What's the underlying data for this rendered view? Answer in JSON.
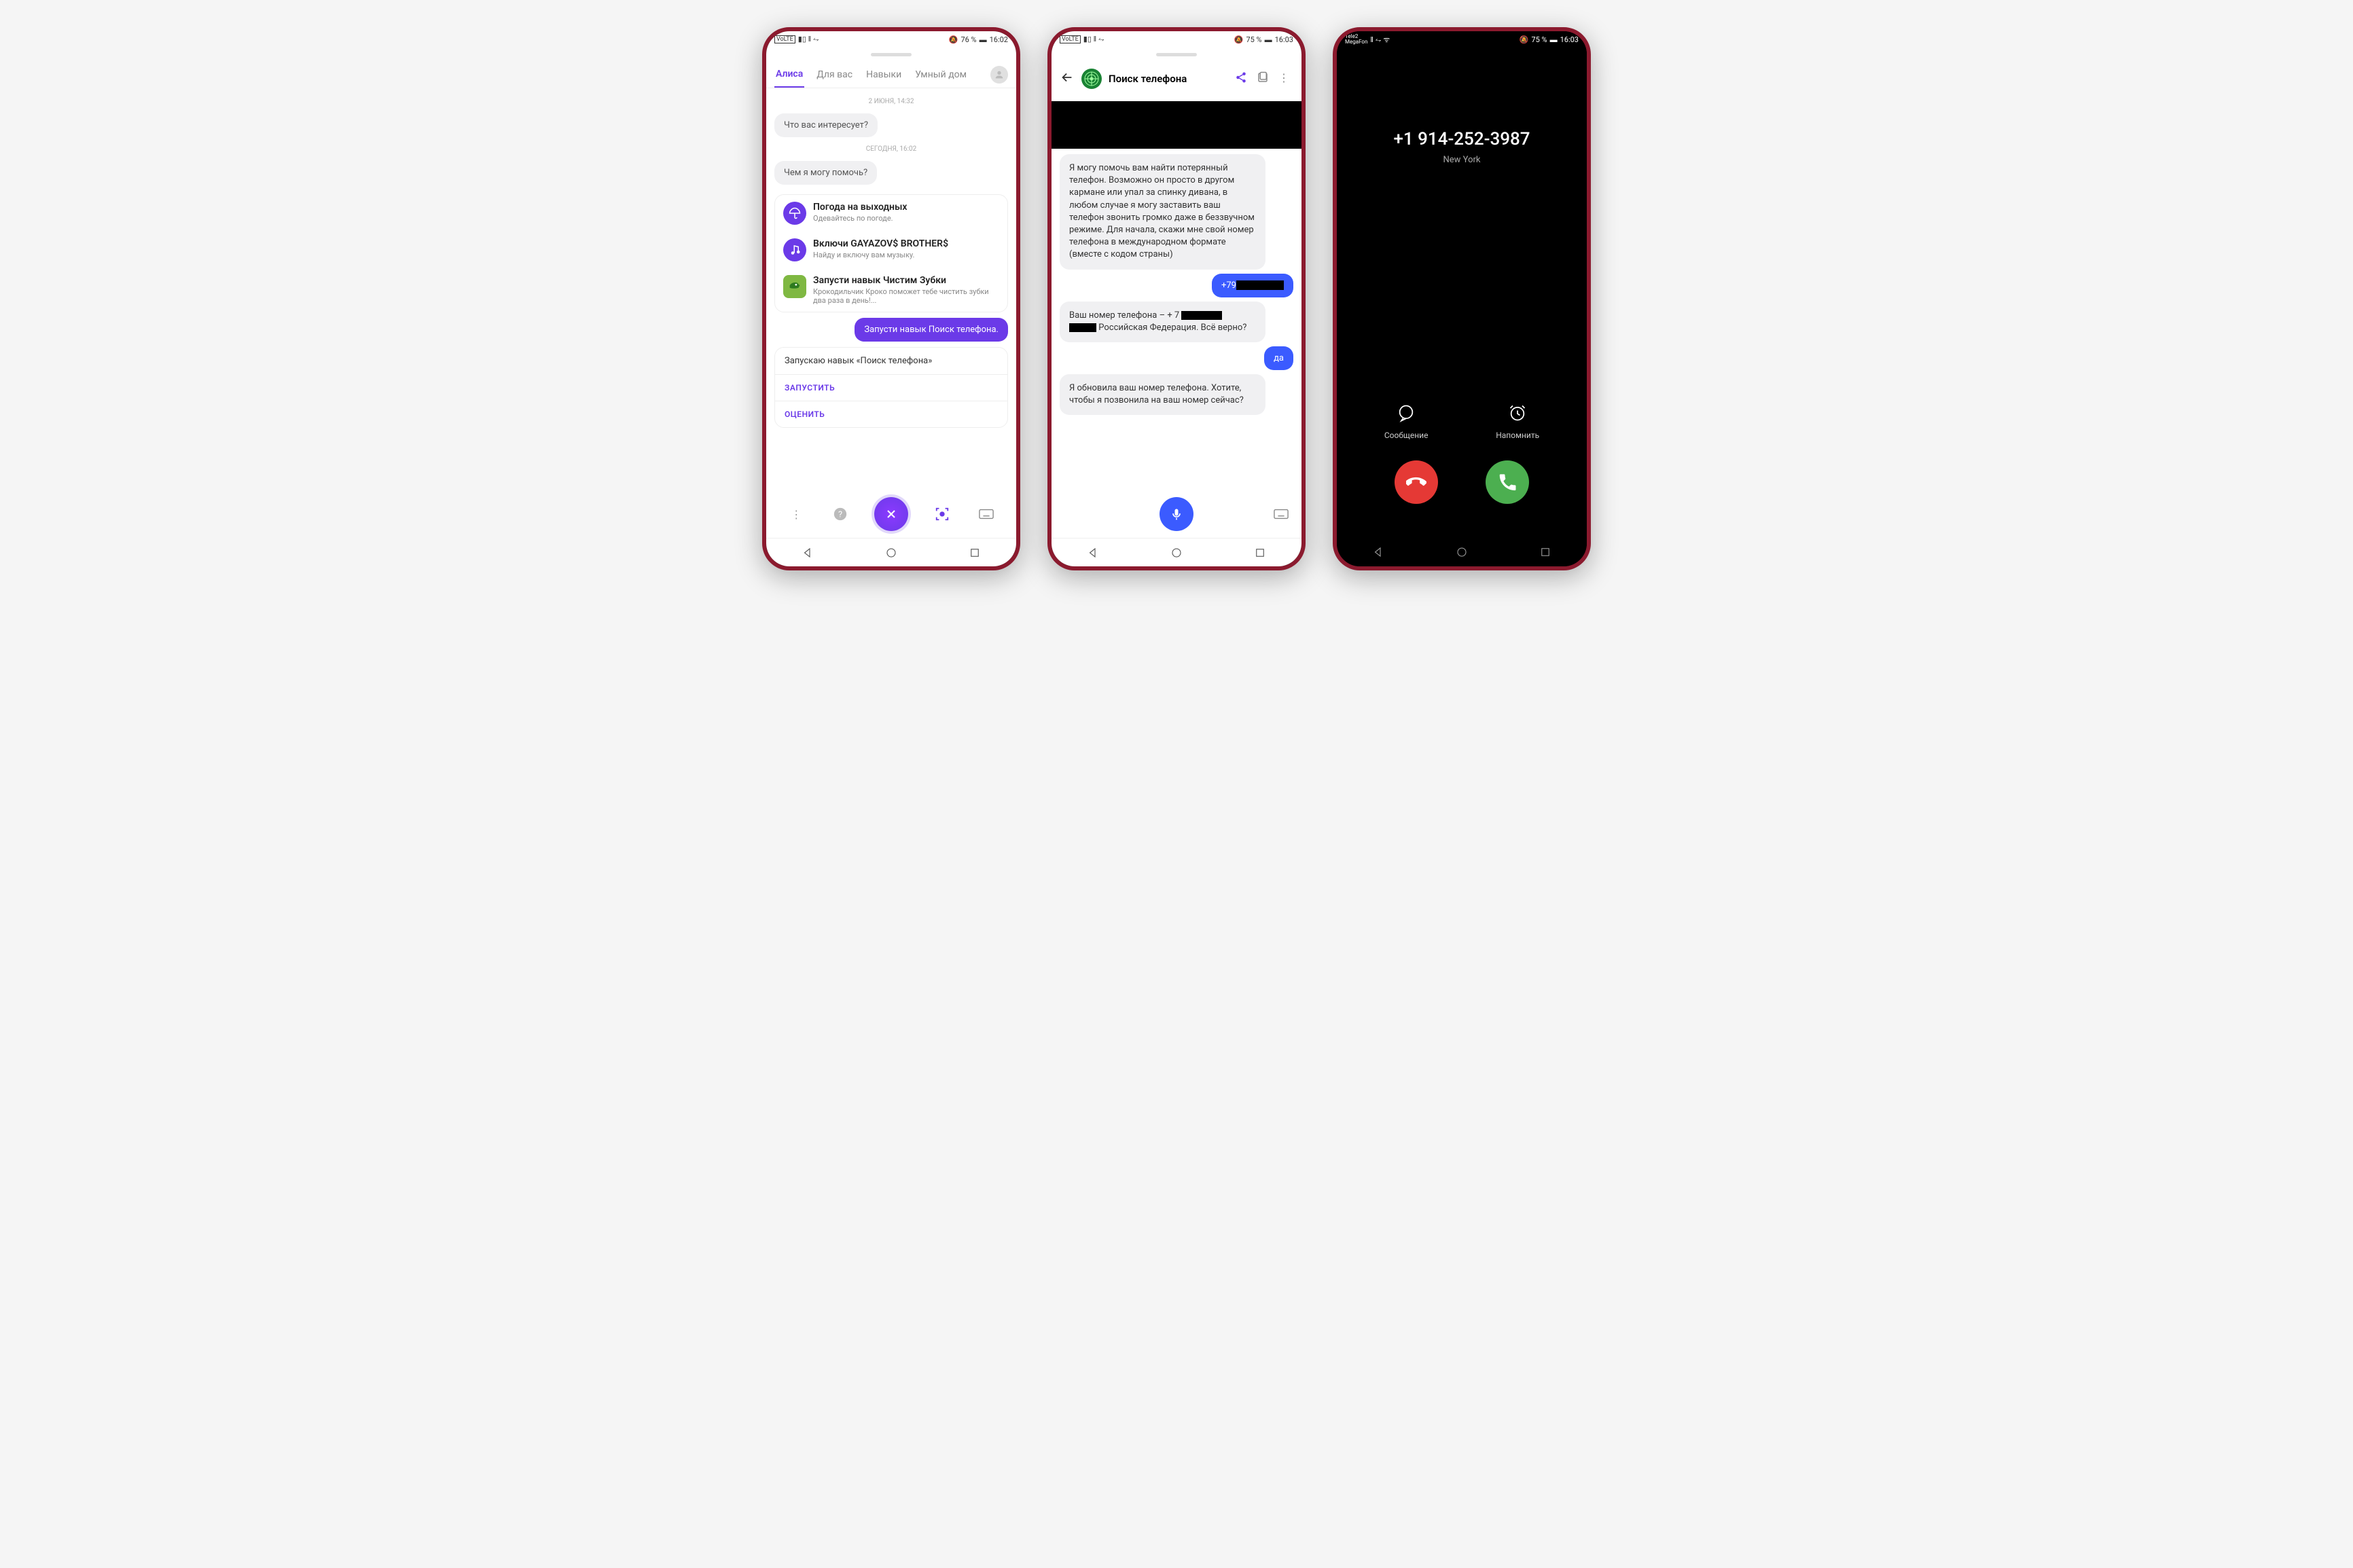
{
  "phone1": {
    "status": {
      "battery": "76 %",
      "time": "16:02"
    },
    "tabs": [
      "Алиса",
      "Для вас",
      "Навыки",
      "Умный дом"
    ],
    "timestamp1": "2 ИЮНЯ, 14:32",
    "greeting1": "Что вас интересует?",
    "timestamp2": "СЕГОДНЯ, 16:02",
    "greeting2": "Чем я могу помочь?",
    "cards": [
      {
        "title": "Погода на выходных",
        "sub": "Одевайтесь по погоде."
      },
      {
        "title": "Включи GAYAZOV$ BROTHER$",
        "sub": "Найду и включу вам музыку."
      },
      {
        "title": "Запусти навык Чистим Зубки",
        "sub": "Крокодильчик Кроко поможет тебе чистить зубки два раза в день!..."
      }
    ],
    "user_msg": "Запусти навык Поиск телефона.",
    "response_header": "Запускаю навык «Поиск телефона»",
    "action_launch": "ЗАПУСТИТЬ",
    "action_rate": "ОЦЕНИТЬ"
  },
  "phone2": {
    "status": {
      "battery": "75 %",
      "time": "16:03"
    },
    "title": "Поиск телефона",
    "intro": "Я могу помочь вам найти потерянный телефон. Возможно он просто в другом кармане или упал за спинку дивана, в любом случае я могу заставить ваш телефон звонить громко даже в беззвучном режиме. Для начала, скажи мне свой номер телефона в международном формате (вместе с кодом страны)",
    "user_number": "+79",
    "confirm_pre": "Ваш номер телефона – + 7",
    "confirm_post": "Российская Федерация. Всё верно?",
    "user_yes": "да",
    "updated": "Я обновила ваш номер телефона. Хотите, чтобы я позвонила на ваш номер сейчас?"
  },
  "phone3": {
    "status": {
      "carrier1": "Tele2",
      "carrier2": "MegaFon",
      "battery": "75 %",
      "time": "16:03"
    },
    "number": "+1 914-252-3987",
    "location": "New York",
    "action_message": "Сообщение",
    "action_remind": "Напомнить"
  }
}
